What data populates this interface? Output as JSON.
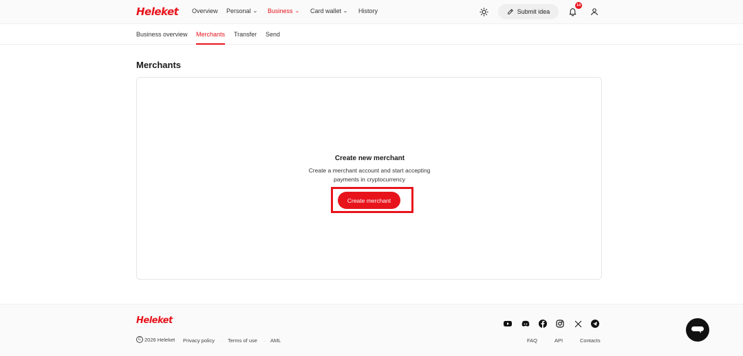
{
  "header": {
    "logo": "Heleket",
    "nav": [
      {
        "label": "Overview",
        "active": false,
        "has_dropdown": false
      },
      {
        "label": "Personal",
        "active": false,
        "has_dropdown": true
      },
      {
        "label": "Business",
        "active": true,
        "has_dropdown": true
      },
      {
        "label": "Card wallet",
        "active": false,
        "has_dropdown": true
      },
      {
        "label": "History",
        "active": false,
        "has_dropdown": false
      }
    ],
    "submit_idea": "Submit idea",
    "notification_count": "14",
    "icons": [
      "sun-icon",
      "pencil-icon",
      "bell-icon",
      "user-icon"
    ]
  },
  "subtabs": [
    {
      "label": "Business overview",
      "active": false
    },
    {
      "label": "Merchants",
      "active": true
    },
    {
      "label": "Transfer",
      "active": false
    },
    {
      "label": "Send",
      "active": false
    }
  ],
  "main": {
    "title": "Merchants",
    "empty_state": {
      "title": "Create new merchant",
      "description": "Create a merchant account and start accepting payments in cryptocurrency",
      "button": "Create merchant"
    }
  },
  "footer": {
    "logo": "Heleket",
    "copyright": "2026 Heleket",
    "links_left": [
      "Privacy policy",
      "Terms of use",
      "AML"
    ],
    "links_right": [
      "FAQ",
      "API",
      "Contacts"
    ],
    "social": [
      "youtube-icon",
      "discord-icon",
      "facebook-icon",
      "instagram-icon",
      "x-icon",
      "telegram-icon"
    ]
  },
  "colors": {
    "accent": "#e8141c",
    "text": "#1a1a1a",
    "background": "#ffffff",
    "footer_bg": "#fafafa"
  }
}
